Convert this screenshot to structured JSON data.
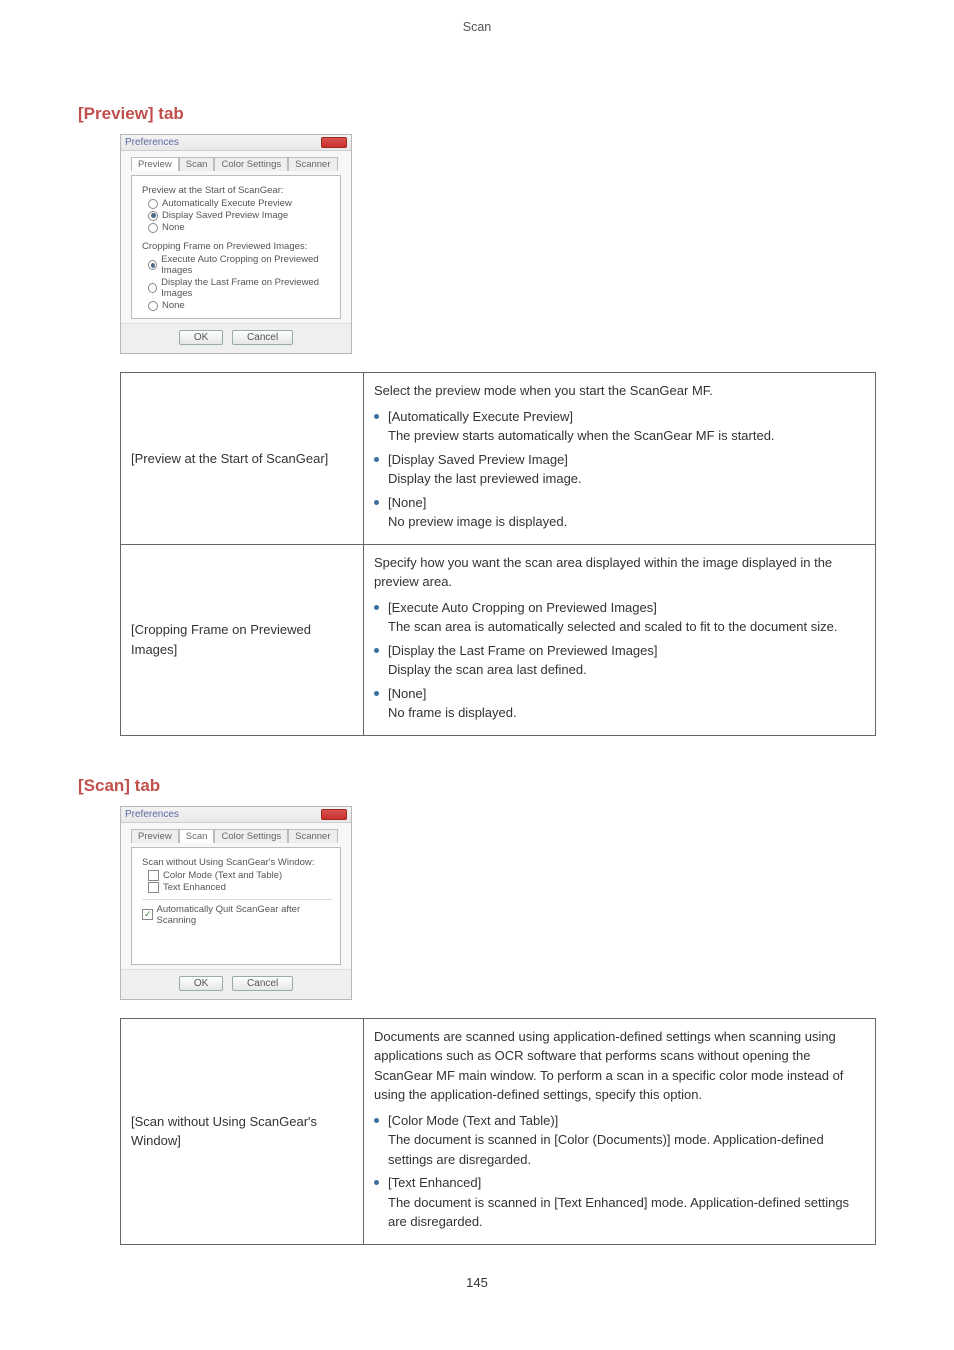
{
  "header_label": "Scan",
  "page_number": "145",
  "preview": {
    "heading": "[Preview] tab",
    "dialog": {
      "title": "Preferences",
      "tabs": {
        "preview": "Preview",
        "scan": "Scan",
        "color": "Color Settings",
        "scanner": "Scanner"
      },
      "group1_label": "Preview at the Start of ScanGear:",
      "g1_opt1": "Automatically Execute Preview",
      "g1_opt2": "Display Saved Preview Image",
      "g1_opt3": "None",
      "group2_label": "Cropping Frame on Previewed Images:",
      "g2_opt1": "Execute Auto Cropping on Previewed Images",
      "g2_opt2": "Display the Last Frame on Previewed Images",
      "g2_opt3": "None",
      "ok": "OK",
      "cancel": "Cancel"
    },
    "row1": {
      "left": "[Preview at the Start of ScanGear]",
      "intro": "Select the preview mode when you start the ScanGear MF.",
      "b1_t": "[Automatically Execute Preview]",
      "b1_d": "The preview starts automatically when the ScanGear MF is started.",
      "b2_t": "[Display Saved Preview Image]",
      "b2_d": "Display the last previewed image.",
      "b3_t": "[None]",
      "b3_d": "No preview image is displayed."
    },
    "row2": {
      "left": "[Cropping Frame on Previewed Images]",
      "intro": "Specify how you want the scan area displayed within the image displayed in the preview area.",
      "b1_t": "[Execute Auto Cropping on Previewed Images]",
      "b1_d": "The scan area is automatically selected and scaled to fit to the document size.",
      "b2_t": "[Display the Last Frame on Previewed Images]",
      "b2_d": "Display the scan area last defined.",
      "b3_t": "[None]",
      "b3_d": "No frame is displayed."
    }
  },
  "scan": {
    "heading": "[Scan] tab",
    "dialog": {
      "title": "Preferences",
      "tabs": {
        "preview": "Preview",
        "scan": "Scan",
        "color": "Color Settings",
        "scanner": "Scanner"
      },
      "group1_label": "Scan without Using ScanGear's Window:",
      "g1_opt1": "Color Mode (Text and Table)",
      "g1_opt2": "Text Enhanced",
      "auto_quit": "Automatically Quit ScanGear after Scanning",
      "ok": "OK",
      "cancel": "Cancel"
    },
    "row1": {
      "left": "[Scan without Using ScanGear's Window]",
      "intro": "Documents are scanned using application-defined settings when scanning using applications such as OCR software that performs scans without opening the ScanGear MF main window. To perform a scan in a specific color mode instead of using the application-defined settings, specify this option.",
      "b1_t": "[Color Mode (Text and Table)]",
      "b1_d": "The document is scanned in [Color (Documents)] mode. Application-defined settings are disregarded.",
      "b2_t": "[Text Enhanced]",
      "b2_d": "The document is scanned in [Text Enhanced] mode. Application-defined settings are disregarded."
    }
  }
}
